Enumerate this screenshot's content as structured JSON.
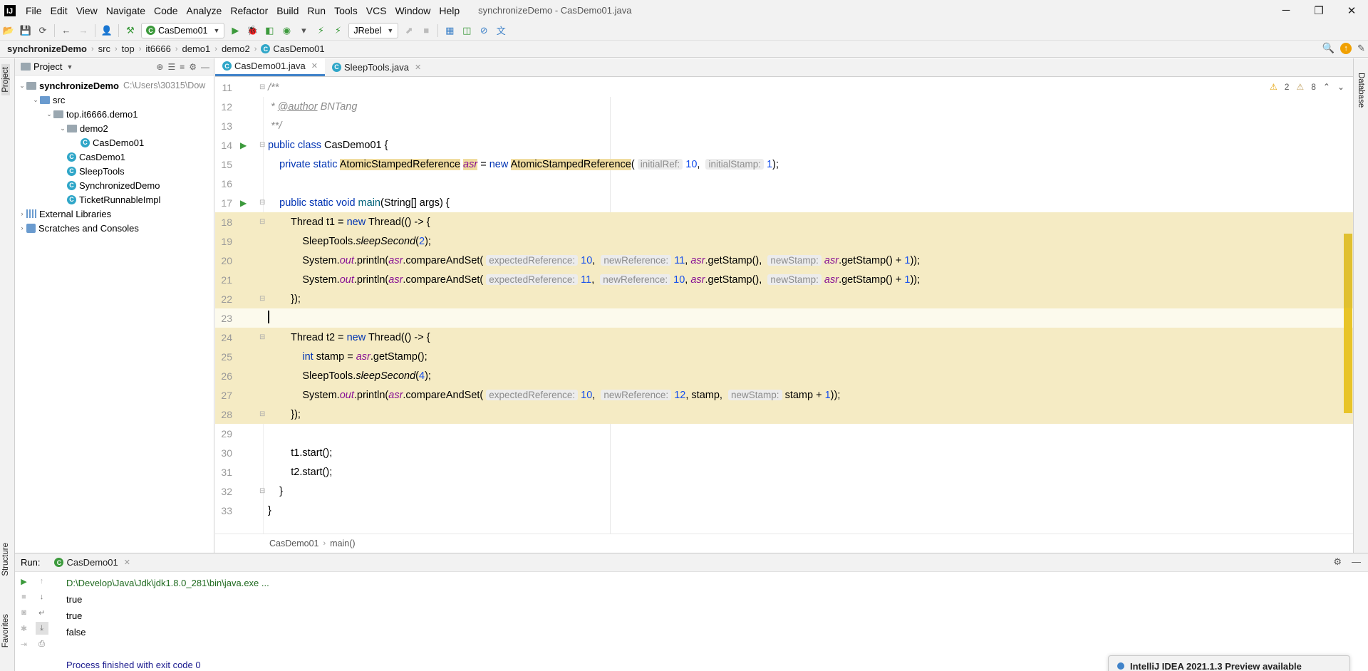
{
  "window": {
    "title": "synchronizeDemo - CasDemo01.java",
    "minimize": "─",
    "maximize": "❐",
    "close": "✕"
  },
  "menu": [
    "File",
    "Edit",
    "View",
    "Navigate",
    "Code",
    "Analyze",
    "Refactor",
    "Build",
    "Run",
    "Tools",
    "VCS",
    "Window",
    "Help"
  ],
  "toolbar": {
    "run_config": "CasDemo01",
    "jrebel": "JRebel"
  },
  "breadcrumb": [
    "synchronizeDemo",
    "src",
    "top",
    "it6666",
    "demo1",
    "demo2",
    "CasDemo01"
  ],
  "side_tabs": {
    "project": "Project",
    "structure": "Structure",
    "favorites": "Favorites",
    "database": "Database"
  },
  "project": {
    "header": "Project",
    "tree": [
      {
        "label": "synchronizeDemo",
        "path": "C:\\Users\\30315\\Dow",
        "indent": 0,
        "arrow": "⌄",
        "icon": "folder"
      },
      {
        "label": "src",
        "indent": 1,
        "arrow": "⌄",
        "icon": "folder-blue"
      },
      {
        "label": "top.it6666.demo1",
        "indent": 2,
        "arrow": "⌄",
        "icon": "folder"
      },
      {
        "label": "demo2",
        "indent": 3,
        "arrow": "⌄",
        "icon": "folder"
      },
      {
        "label": "CasDemo01",
        "indent": 4,
        "arrow": "",
        "icon": "class"
      },
      {
        "label": "CasDemo1",
        "indent": 3,
        "arrow": "",
        "icon": "class"
      },
      {
        "label": "SleepTools",
        "indent": 3,
        "arrow": "",
        "icon": "class"
      },
      {
        "label": "SynchronizedDemo",
        "indent": 3,
        "arrow": "",
        "icon": "class"
      },
      {
        "label": "TicketRunnableImpl",
        "indent": 3,
        "arrow": "",
        "icon": "class"
      },
      {
        "label": "External Libraries",
        "indent": 0,
        "arrow": "›",
        "icon": "lib"
      },
      {
        "label": "Scratches and Consoles",
        "indent": 0,
        "arrow": "›",
        "icon": "scratch"
      }
    ]
  },
  "editor": {
    "tabs": [
      {
        "label": "CasDemo01.java",
        "active": true
      },
      {
        "label": "SleepTools.java",
        "active": false
      }
    ],
    "inspections": {
      "warnings": "2",
      "weak_warnings": "8"
    },
    "breadcrumb": [
      "CasDemo01",
      "main()"
    ],
    "lines": [
      {
        "n": "11",
        "html": "<span class=\"cmt\">/**</span>"
      },
      {
        "n": "12",
        "html": "<span class=\"cmt\"> * </span><span class=\"tag\">@author</span><span class=\"cmt\"> BNTang</span>"
      },
      {
        "n": "13",
        "html": "<span class=\"cmt\"> **/</span>"
      },
      {
        "n": "14",
        "run": true,
        "html": "<span class=\"kw\">public class</span> CasDemo01 {"
      },
      {
        "n": "15",
        "html": "    <span class=\"kw\">private static</span> <span class=\"typ-hl\">AtomicStampedReference</span> <span class=\"sfld typ-hl\">asr</span> = <span class=\"kw\">new</span> <span class=\"typ-hl\">AtomicStampedReference</span>( <span class=\"hint\">initialRef:</span> <span class=\"num\">10</span>,  <span class=\"hint\">initialStamp:</span> <span class=\"num\">1</span>);"
      },
      {
        "n": "16",
        "html": ""
      },
      {
        "n": "17",
        "run": true,
        "html": "    <span class=\"kw\">public static void</span> <span class=\"mth\">main</span>(String[] args) {"
      },
      {
        "n": "18",
        "hl": true,
        "html": "        Thread t1 = <span class=\"kw\">new</span> Thread(() -> {"
      },
      {
        "n": "19",
        "hl": true,
        "html": "            SleepTools.<span class=\"stat-mth\">sleepSecond</span>(<span class=\"num\">2</span>);"
      },
      {
        "n": "20",
        "hl": true,
        "html": "            System.<span class=\"sfld\">out</span>.println(<span class=\"sfld\">asr</span>.compareAndSet( <span class=\"hint\">expectedReference:</span> <span class=\"num\">10</span>,  <span class=\"hint\">newReference:</span> <span class=\"num\">11</span>, <span class=\"sfld\">asr</span>.getStamp(),  <span class=\"hint\">newStamp:</span> <span class=\"sfld\">asr</span>.getStamp() + <span class=\"num\">1</span>));"
      },
      {
        "n": "21",
        "hl": true,
        "html": "            System.<span class=\"sfld\">out</span>.println(<span class=\"sfld\">asr</span>.compareAndSet( <span class=\"hint\">expectedReference:</span> <span class=\"num\">11</span>,  <span class=\"hint\">newReference:</span> <span class=\"num\">10</span>, <span class=\"sfld\">asr</span>.getStamp(),  <span class=\"hint\">newStamp:</span> <span class=\"sfld\">asr</span>.getStamp() + <span class=\"num\">1</span>));"
      },
      {
        "n": "22",
        "hl": true,
        "html": "        });"
      },
      {
        "n": "23",
        "cur": true,
        "html": ""
      },
      {
        "n": "24",
        "hl": true,
        "html": "        Thread t2 = <span class=\"kw\">new</span> Thread(() -> {"
      },
      {
        "n": "25",
        "hl": true,
        "html": "            <span class=\"kw\">int</span> stamp = <span class=\"sfld\">asr</span>.getStamp();"
      },
      {
        "n": "26",
        "hl": true,
        "html": "            SleepTools.<span class=\"stat-mth\">sleepSecond</span>(<span class=\"num\">4</span>);"
      },
      {
        "n": "27",
        "hl": true,
        "html": "            System.<span class=\"sfld\">out</span>.println(<span class=\"sfld\">asr</span>.compareAndSet( <span class=\"hint\">expectedReference:</span> <span class=\"num\">10</span>,  <span class=\"hint\">newReference:</span> <span class=\"num\">12</span>, stamp,  <span class=\"hint\">newStamp:</span> stamp + <span class=\"num\">1</span>));"
      },
      {
        "n": "28",
        "hl": true,
        "html": "        });"
      },
      {
        "n": "29",
        "html": ""
      },
      {
        "n": "30",
        "html": "        t1.start();"
      },
      {
        "n": "31",
        "html": "        t2.start();"
      },
      {
        "n": "32",
        "html": "    }"
      },
      {
        "n": "33",
        "html": "}"
      }
    ]
  },
  "run_panel": {
    "label": "Run:",
    "tab": "CasDemo01",
    "console": [
      {
        "text": "D:\\Develop\\Java\\Jdk\\jdk1.8.0_281\\bin\\java.exe ...",
        "kind": "cmd"
      },
      {
        "text": "true",
        "kind": "out"
      },
      {
        "text": "true",
        "kind": "out"
      },
      {
        "text": "false",
        "kind": "out"
      },
      {
        "text": "",
        "kind": "out"
      },
      {
        "text": "Process finished with exit code 0",
        "kind": "exit"
      }
    ]
  },
  "notification": {
    "text": "IntelliJ IDEA 2021.1.3 Preview available"
  },
  "colors": {
    "highlight": "#f5ebc4",
    "keyword": "#0033b3",
    "field": "#871094",
    "number": "#1750eb",
    "accent": "#4083c9"
  }
}
